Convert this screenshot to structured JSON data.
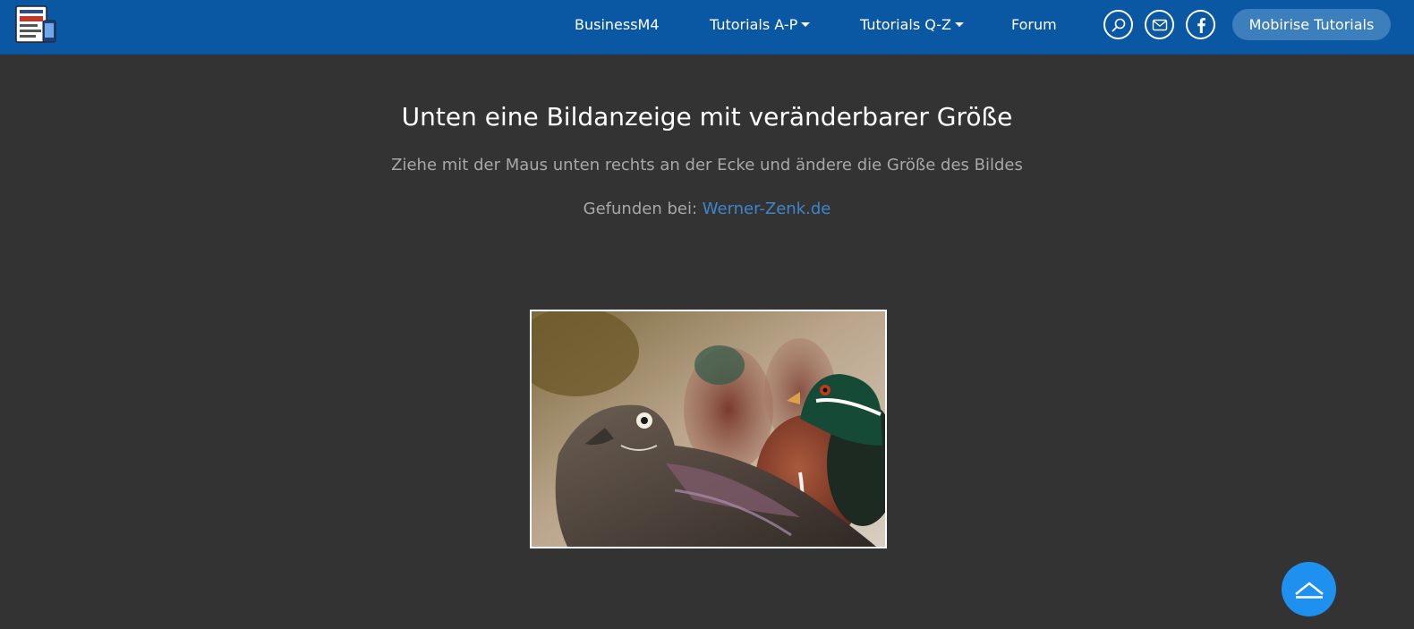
{
  "navbar": {
    "logo_icon": "tutorials-book-logo-icon",
    "items": [
      {
        "label": "BusinessM4",
        "dropdown": false
      },
      {
        "label": "Tutorials A-P",
        "dropdown": true
      },
      {
        "label": "Tutorials Q-Z",
        "dropdown": true
      },
      {
        "label": "Forum",
        "dropdown": false
      }
    ],
    "icons": [
      "search-icon",
      "mail-icon",
      "facebook-icon"
    ],
    "cta_label": "Mobirise Tutorials",
    "colors": {
      "bar": "#0a58a3",
      "cta": "#3d7ebd"
    }
  },
  "content": {
    "title": "Unten eine Bildanzeige mit veränderbarer Größe",
    "subtitle": "Ziehe mit der Maus unten rechts an der Ecke und ändere die Größe des Bildes",
    "found_prefix": "Gefunden bei: ",
    "found_link": "Werner-Zenk.de",
    "image_subject": "wood-ducks-photo"
  },
  "scroll_top": {
    "icon": "chevron-up-icon",
    "color": "#1e90f0"
  }
}
